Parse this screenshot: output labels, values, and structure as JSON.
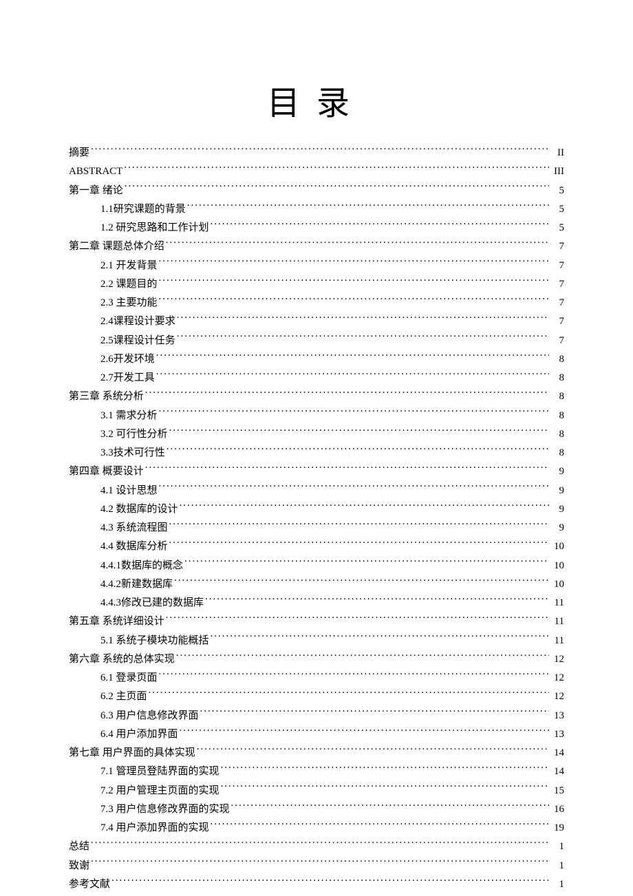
{
  "title": "目录",
  "toc": [
    {
      "level": 0,
      "label": "摘要",
      "page": "II"
    },
    {
      "level": 0,
      "label": "ABSTRACT",
      "page": "III"
    },
    {
      "level": 0,
      "label": "第一章  绪论",
      "page": "5"
    },
    {
      "level": 1,
      "label": "1.1研究课题的背景",
      "page": "5"
    },
    {
      "level": 1,
      "label": "1.2 研究思路和工作计划",
      "page": "5"
    },
    {
      "level": 0,
      "label": "第二章  课题总体介绍",
      "page": "7"
    },
    {
      "level": 1,
      "label": "2.1 开发背景",
      "page": "7"
    },
    {
      "level": 1,
      "label": "2.2 课题目的",
      "page": "7"
    },
    {
      "level": 1,
      "label": "2.3 主要功能",
      "page": "7"
    },
    {
      "level": 1,
      "label": "2.4课程设计要求",
      "page": "7"
    },
    {
      "level": 1,
      "label": "2.5课程设计任务",
      "page": "7"
    },
    {
      "level": 1,
      "label": "2.6开发环境",
      "page": "8"
    },
    {
      "level": 1,
      "label": "2.7开发工具",
      "page": "8"
    },
    {
      "level": 0,
      "label": "第三章  系统分析",
      "page": "8"
    },
    {
      "level": 1,
      "label": "3.1 需求分析",
      "page": "8"
    },
    {
      "level": 1,
      "label": "3.2 可行性分析",
      "page": "8"
    },
    {
      "level": 1,
      "label": "3.3技术可行性",
      "page": "8"
    },
    {
      "level": 0,
      "label": "第四章 概要设计",
      "page": "9"
    },
    {
      "level": 1,
      "label": "4.1 设计思想",
      "page": "9"
    },
    {
      "level": 1,
      "label": "4.2 数据库的设计",
      "page": "9"
    },
    {
      "level": 1,
      "label": "4.3 系统流程图",
      "page": "9"
    },
    {
      "level": 1,
      "label": "4.4 数据库分析",
      "page": "10"
    },
    {
      "level": 1,
      "label": "4.4.1数据库的概念",
      "page": "10"
    },
    {
      "level": 1,
      "label": "4.4.2新建数据库",
      "page": "10"
    },
    {
      "level": 1,
      "label": "4.4.3修改已建的数据库",
      "page": "11"
    },
    {
      "level": 0,
      "label": "第五章  系统详细设计",
      "page": "11"
    },
    {
      "level": 1,
      "label": "5.1 系统子模块功能概括",
      "page": "11"
    },
    {
      "level": 0,
      "label": "第六章  系统的总体实现",
      "page": "12"
    },
    {
      "level": 1,
      "label": "6.1 登录页面",
      "page": "12"
    },
    {
      "level": 1,
      "label": "6.2 主页面",
      "page": "12"
    },
    {
      "level": 1,
      "label": "6.3 用户信息修改界面",
      "page": "13"
    },
    {
      "level": 1,
      "label": "6.4 用户添加界面",
      "page": "13"
    },
    {
      "level": 0,
      "label": "第七章  用户界面的具体实现",
      "page": "14"
    },
    {
      "level": 1,
      "label": "7.1 管理员登陆界面的实现",
      "page": "14"
    },
    {
      "level": 1,
      "label": "7.2 用户管理主页面的实现",
      "page": "15"
    },
    {
      "level": 1,
      "label": "7.3 用户信息修改界面的实现",
      "page": "16"
    },
    {
      "level": 1,
      "label": "7.4 用户添加界面的实现",
      "page": "19"
    },
    {
      "level": 0,
      "label": "总结",
      "page": "1"
    },
    {
      "level": 0,
      "label": "致谢",
      "page": "1"
    },
    {
      "level": 0,
      "label": "参考文献",
      "page": "1"
    }
  ]
}
